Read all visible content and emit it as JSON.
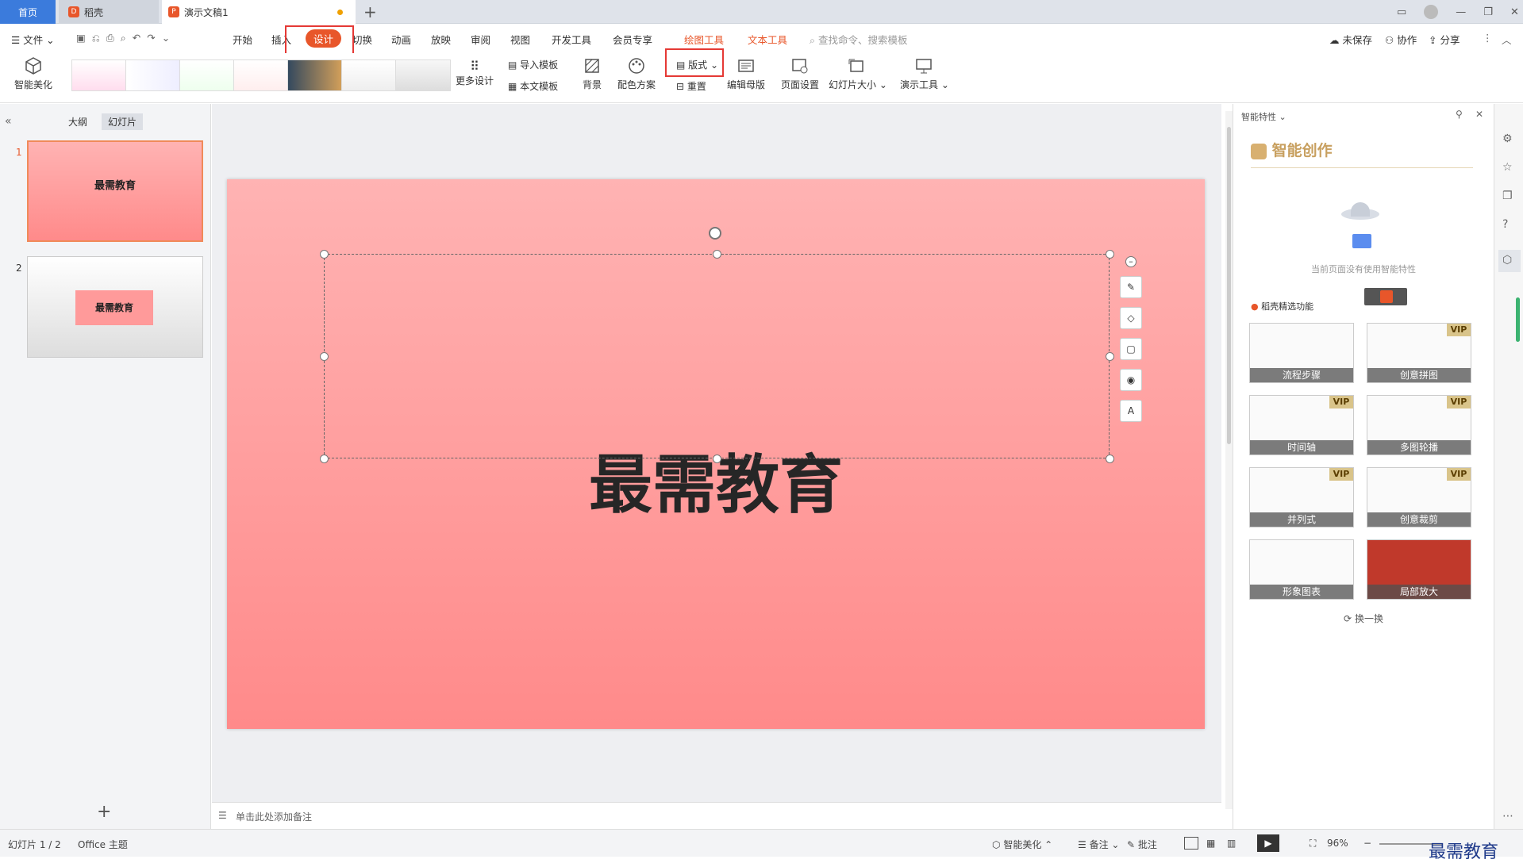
{
  "tabs": {
    "home": "首页",
    "daoke": "稻壳",
    "doc": "演示文稿1"
  },
  "menu": {
    "file": "文件",
    "items": [
      "开始",
      "插入",
      "设计",
      "切换",
      "动画",
      "放映",
      "审阅",
      "视图",
      "开发工具",
      "会员专享"
    ],
    "active": "设计",
    "context1": "绘图工具",
    "context2": "文本工具",
    "search_placeholder": "查找命令、搜索模板",
    "unsaved": "未保存",
    "collab": "协作",
    "share": "分享"
  },
  "ribbon": {
    "smart": "智能美化",
    "more_design": "更多设计",
    "import_tpl": "导入模板",
    "this_tpl": "本文模板",
    "background": "背景",
    "color_scheme": "配色方案",
    "layout": "版式",
    "reset": "重置",
    "edit_master": "编辑母版",
    "page_setup": "页面设置",
    "slide_size": "幻灯片大小",
    "present_tools": "演示工具"
  },
  "left": {
    "outline": "大纲",
    "slides": "幻灯片",
    "nums": [
      "1",
      "2"
    ],
    "s1": "最需教育",
    "s2": "最需教育"
  },
  "slide": {
    "title": "最需教育"
  },
  "notes": {
    "placeholder": "单击此处添加备注"
  },
  "right": {
    "panel_title": "智能特性",
    "header": "智能创作",
    "empty": "当前页面没有使用智能特性",
    "section": "稻壳精选功能",
    "cards": [
      {
        "name": "流程步骤",
        "vip": false
      },
      {
        "name": "创意拼图",
        "vip": true
      },
      {
        "name": "时间轴",
        "vip": true
      },
      {
        "name": "多图轮播",
        "vip": true
      },
      {
        "name": "并列式",
        "vip": true
      },
      {
        "name": "创意裁剪",
        "vip": true
      },
      {
        "name": "形象图表",
        "vip": false
      },
      {
        "name": "局部放大",
        "vip": false
      }
    ],
    "vip_label": "VIP",
    "refresh": "换一换"
  },
  "status": {
    "slide_count": "幻灯片 1 / 2",
    "theme": "Office 主题",
    "smart": "智能美化",
    "notes": "备注",
    "comments": "批注",
    "zoom": "96%"
  },
  "watermark": "最需教育",
  "colors": {
    "accent": "#e8562a",
    "tab_home": "#3b7bdc",
    "slide_top": "#ffb3b3",
    "slide_bottom": "#ff8a8a",
    "highlight": "#e53935"
  }
}
